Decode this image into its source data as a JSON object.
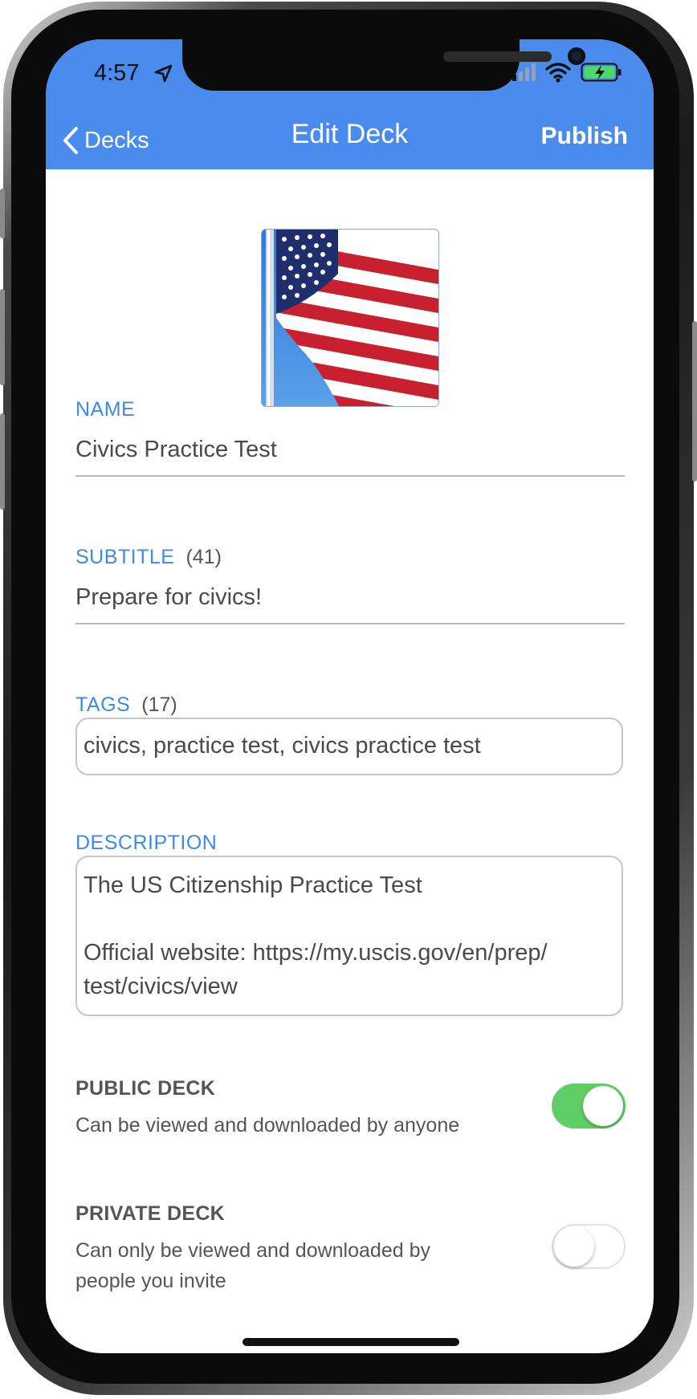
{
  "status_bar": {
    "time": "4:57"
  },
  "nav": {
    "back_label": "Decks",
    "title": "Edit Deck",
    "action_label": "Publish"
  },
  "form": {
    "name": {
      "label": "NAME",
      "value": "Civics Practice Test"
    },
    "subtitle": {
      "label": "SUBTITLE",
      "count": "(41)",
      "value": "Prepare for civics!"
    },
    "tags": {
      "label": "TAGS",
      "count": "(17)",
      "value": "civics, practice test, civics practice test"
    },
    "description": {
      "label": "DESCRIPTION",
      "line1": "The US Citizenship Practice Test",
      "line2": "Official website: https://my.uscis.gov/en/prep/",
      "line3": "test/civics/view"
    }
  },
  "visibility": {
    "public": {
      "title": "PUBLIC DECK",
      "description": "Can be viewed and downloaded by anyone",
      "enabled": true
    },
    "private": {
      "title": "PRIVATE DECK",
      "description_line1": "Can only be viewed and downloaded by",
      "description_line2": "people you invite",
      "enabled": false
    }
  },
  "colors": {
    "accent": "#4a8bee",
    "label": "#3d8be8",
    "toggle_on": "#5fce65"
  }
}
